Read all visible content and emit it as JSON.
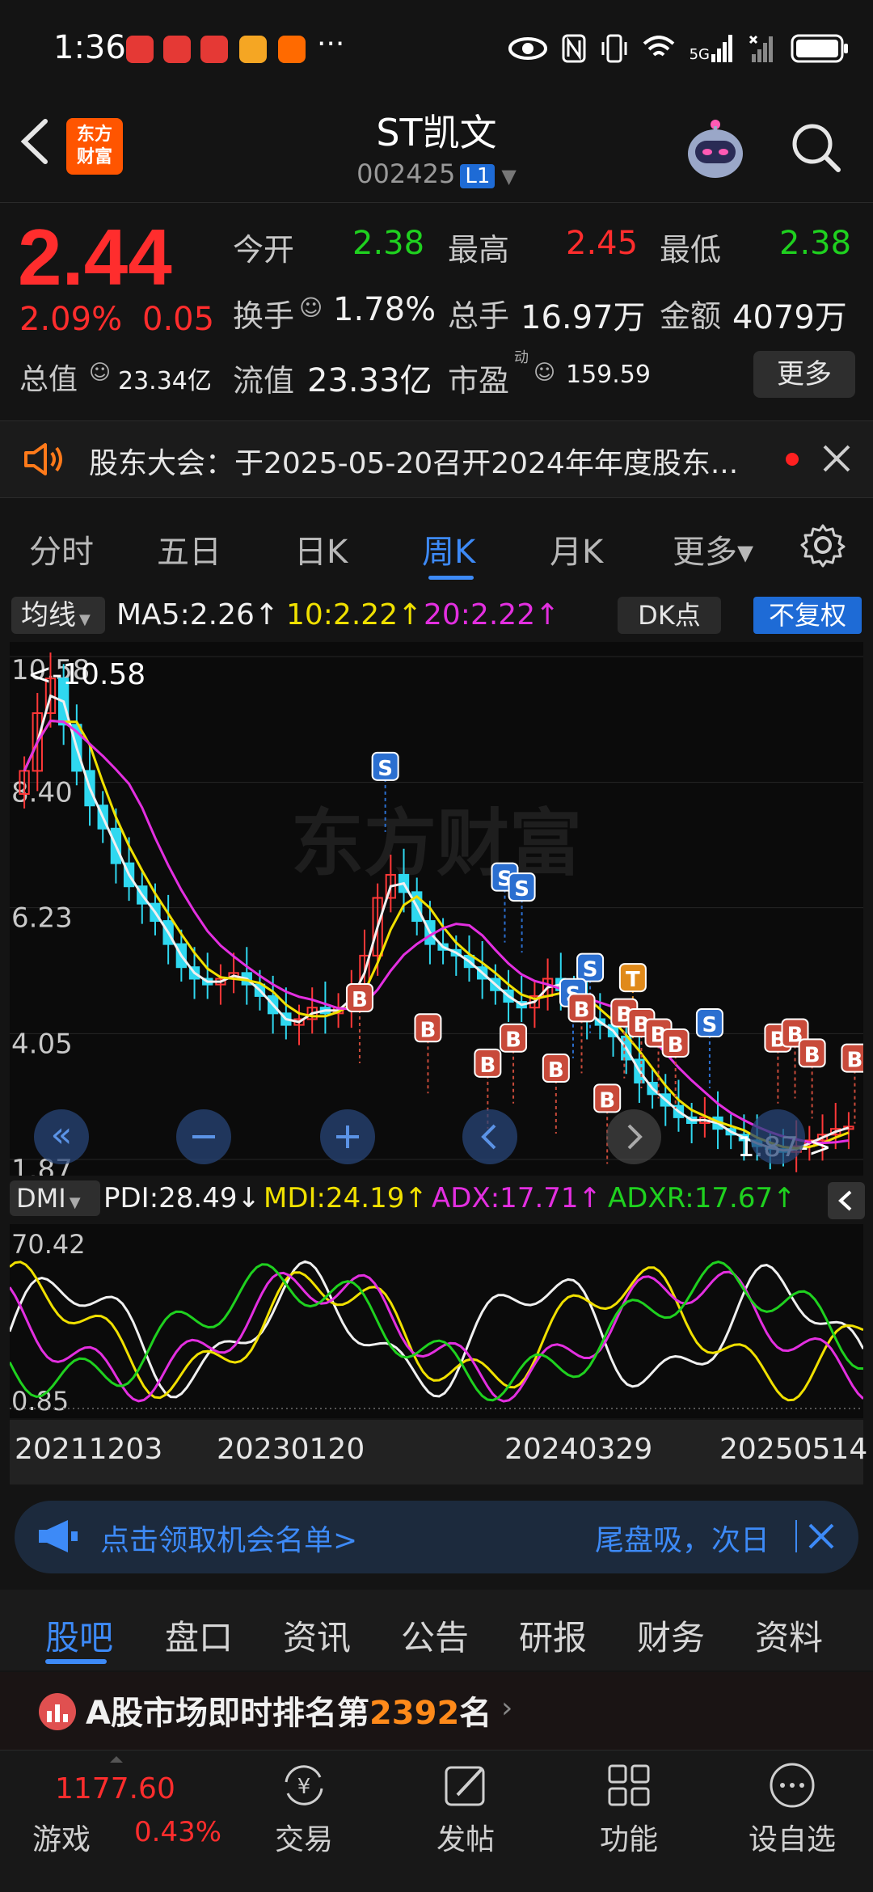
{
  "status_bar": {
    "time": "1:36",
    "more": "···",
    "network": "5G",
    "icons": [
      "wechat-read-icon",
      "wechat-read-icon",
      "wechat-read-icon",
      "weibo-icon",
      "feishu-icon",
      "eye-icon",
      "nfc-icon",
      "vibrate-icon",
      "wifi-icon",
      "signal-icon",
      "battery-icon"
    ]
  },
  "header": {
    "brand": "东方\n财富",
    "brand_line1": "东方",
    "brand_line2": "财富",
    "name": "ST凯文",
    "code": "002425",
    "level": "L1"
  },
  "quote": {
    "price": "2.44",
    "change_pct": "2.09%",
    "change_amt": "0.05",
    "open_label": "今开",
    "open": "2.38",
    "high_label": "最高",
    "high": "2.45",
    "low_label": "最低",
    "low": "2.38",
    "turnover_label": "换手",
    "turnover": "1.78%",
    "volume_label": "总手",
    "volume": "16.97万",
    "amount_label": "金额",
    "amount": "4079万",
    "total_value_label": "总值",
    "total_value": "23.34亿",
    "float_value_label": "流值",
    "float_value": "23.33亿",
    "pe_label": "市盈",
    "pe_sup": "动",
    "pe": "159.59",
    "more_button": "更多"
  },
  "announcement": {
    "text": "股东大会：于2025-05-20召开2024年年度股东..."
  },
  "period_tabs": [
    {
      "label": "分时",
      "active": false
    },
    {
      "label": "五日",
      "active": false
    },
    {
      "label": "日K",
      "active": false
    },
    {
      "label": "周K",
      "active": true
    },
    {
      "label": "月K",
      "active": false
    },
    {
      "label": "更多▾",
      "active": false
    }
  ],
  "ma_bar": {
    "selector": "均线",
    "ma5": "MA5:2.26↑",
    "ma10": "10:2.22↑",
    "ma20": "20:2.22↑",
    "dk_button": "DK点",
    "adjust_button": "不复权"
  },
  "colors": {
    "up": "#ff2d2d",
    "down": "#1fd11f",
    "accent": "#3d8af7",
    "ma5": "#f0f0f0",
    "ma10": "#f0e000",
    "ma20": "#e32fe0"
  },
  "chart_data": [
    {
      "type": "candlestick",
      "title": "",
      "yticks": [
        "10.58",
        "8.40",
        "6.23",
        "4.05",
        "1.87"
      ],
      "ylim": [
        1.87,
        10.58
      ],
      "max_marker": "<-10.58",
      "min_marker": "1.87->",
      "weekly_close": [
        8.6,
        9.6,
        10.2,
        9.4,
        8.6,
        8.0,
        7.6,
        7.0,
        6.6,
        6.3,
        6.0,
        5.6,
        5.2,
        5.0,
        4.9,
        5.0,
        5.1,
        4.9,
        4.7,
        4.4,
        4.2,
        4.3,
        4.5,
        4.4,
        4.5,
        4.8,
        5.4,
        6.4,
        6.8,
        6.5,
        6.0,
        5.6,
        5.5,
        5.4,
        5.2,
        5.0,
        4.8,
        4.6,
        4.5,
        4.7,
        5.0,
        4.8,
        4.6,
        4.3,
        4.2,
        4.0,
        3.6,
        3.2,
        3.0,
        2.8,
        2.6,
        2.5,
        2.6,
        2.4,
        2.3,
        2.2,
        2.1,
        2.05,
        2.0,
        2.1,
        2.2,
        2.3,
        2.4,
        2.44
      ],
      "ma_values": {
        "MA5": "2.26",
        "MA10": "2.22",
        "MA20": "2.22"
      },
      "signals": [
        "S",
        "S",
        "S",
        "S",
        "S",
        "S",
        "T",
        "B",
        "B",
        "B",
        "B",
        "B",
        "B",
        "B",
        "B",
        "B",
        "B",
        "B",
        "B",
        "B",
        "B",
        "B"
      ]
    },
    {
      "type": "line",
      "title": "",
      "indicator": "DMI",
      "ylim": [
        0.85,
        70.42
      ],
      "yticks": [
        "70.42",
        "0.85"
      ],
      "series": [
        {
          "name": "PDI",
          "value": "28.49↓",
          "color": "#f0f0f0"
        },
        {
          "name": "MDI",
          "value": "24.19↑",
          "color": "#f0e000"
        },
        {
          "name": "ADX",
          "value": "17.71↑",
          "color": "#e32fe0"
        },
        {
          "name": "ADXR",
          "value": "17.67↑",
          "color": "#1fd11f"
        }
      ]
    }
  ],
  "dmi_bar": {
    "selector": "DMI",
    "pdi": "PDI:28.49↓",
    "mdi": "MDI:24.19↑",
    "adx": "ADX:17.71↑",
    "adxr": "ADXR:17.67↑"
  },
  "dates": [
    "20211203",
    "20230120",
    "20240329",
    "20250514"
  ],
  "watermark": "东方财富",
  "promo": {
    "text": "点击领取机会名单>",
    "right_text": "尾盘吸，次日"
  },
  "section_tabs": [
    {
      "label": "股吧",
      "active": true
    },
    {
      "label": "盘口",
      "active": false
    },
    {
      "label": "资讯",
      "active": false
    },
    {
      "label": "公告",
      "active": false
    },
    {
      "label": "研报",
      "active": false
    },
    {
      "label": "财务",
      "active": false
    },
    {
      "label": "资料",
      "active": false
    }
  ],
  "rank": {
    "prefix": "A股市场即时排名第",
    "number": "2392",
    "suffix": "名"
  },
  "bottom_nav": {
    "index_name": "游戏",
    "index_value": "1177.60",
    "index_change": "0.43%",
    "items": [
      {
        "label": "交易",
        "icon": "yuan-refresh-icon"
      },
      {
        "label": "发帖",
        "icon": "edit-icon"
      },
      {
        "label": "功能",
        "icon": "grid-icon"
      },
      {
        "label": "设自选",
        "icon": "more-circle-icon"
      }
    ]
  }
}
